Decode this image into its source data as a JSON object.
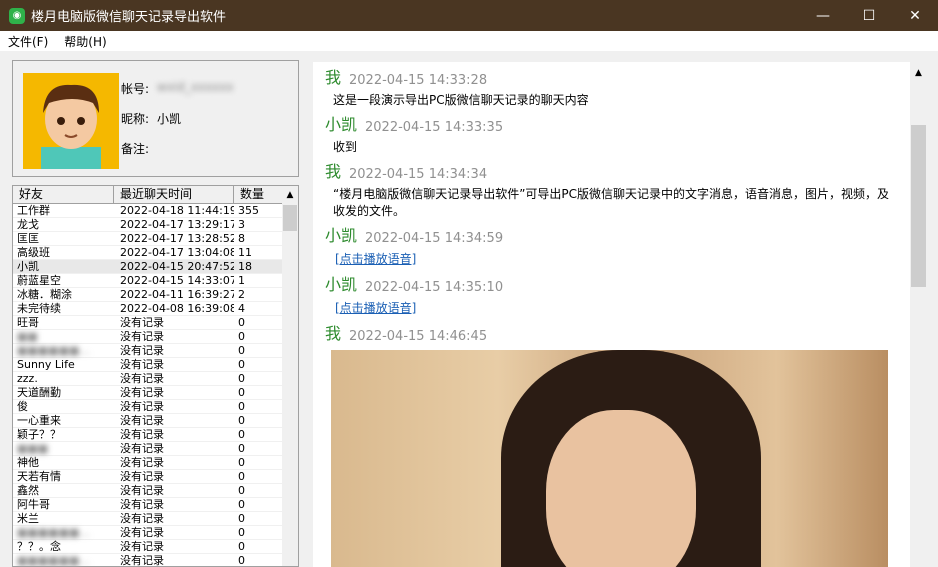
{
  "window": {
    "title": "楼月电脑版微信聊天记录导出软件",
    "icon": "wechat-icon",
    "min": "—",
    "max": "☐",
    "close": "✕"
  },
  "menu": [
    {
      "label": "文件(F)"
    },
    {
      "label": "帮助(H)"
    }
  ],
  "profile": {
    "account_label": "帐号:",
    "account_value": "wxid_xxxxxx",
    "nickname_label": "昵称:",
    "nickname": "小凯",
    "remark_label": "备注:"
  },
  "friends": {
    "headers": [
      "好友",
      "最近聊天时间",
      "数量"
    ],
    "rows": [
      [
        "工作群",
        "2022-04-18 11:44:19",
        "355"
      ],
      [
        "龙戈",
        "2022-04-17 13:29:17",
        "3"
      ],
      [
        "匡匡",
        "2022-04-17 13:28:52",
        "8"
      ],
      [
        "高级班",
        "2022-04-17 13:04:08",
        "11"
      ],
      [
        "小凯",
        "2022-04-15 20:47:52",
        "18"
      ],
      [
        "蔚蓝星空",
        "2022-04-15 14:33:07",
        "1"
      ],
      [
        "冰糖．糊涂",
        "2022-04-11 16:39:27",
        "2"
      ],
      [
        "未完待续",
        "2022-04-08 16:39:08",
        "4"
      ],
      [
        "旺哥",
        "没有记录",
        "0"
      ],
      [
        "■■",
        "没有记录",
        "0"
      ],
      [
        "■■■■■■...",
        "没有记录",
        "0"
      ],
      [
        "Sunny Life",
        "没有记录",
        "0"
      ],
      [
        "zzz.",
        "没有记录",
        "0"
      ],
      [
        "天道酬勤",
        "没有记录",
        "0"
      ],
      [
        "俊",
        "没有记录",
        "0"
      ],
      [
        "一心重来",
        "没有记录",
        "0"
      ],
      [
        "颖子？？",
        "没有记录",
        "0"
      ],
      [
        "■■■",
        "没有记录",
        "0"
      ],
      [
        "神他",
        "没有记录",
        "0"
      ],
      [
        "天若有情",
        "没有记录",
        "0"
      ],
      [
        "鑫然",
        "没有记录",
        "0"
      ],
      [
        "阿牛哥",
        "没有记录",
        "0"
      ],
      [
        "米兰",
        "没有记录",
        "0"
      ],
      [
        "■■■■■■...",
        "没有记录",
        "0"
      ],
      [
        "？？。念",
        "没有记录",
        "0"
      ],
      [
        "■■■■■■...",
        "没有记录",
        "0"
      ]
    ]
  },
  "messages": [
    {
      "sender": "我",
      "time": "2022-04-15 14:33:28",
      "text": "这是一段演示导出PC版微信聊天记录的聊天内容"
    },
    {
      "sender": "小凯",
      "time": "2022-04-15 14:33:35",
      "text": "收到"
    },
    {
      "sender": "我",
      "time": "2022-04-15 14:34:34",
      "text": "“楼月电脑版微信聊天记录导出软件”可导出PC版微信聊天记录中的文字消息，语音消息，图片，视频，及收发的文件。"
    },
    {
      "sender": "小凯",
      "time": "2022-04-15 14:34:59",
      "link": "[点击播放语音]"
    },
    {
      "sender": "小凯",
      "time": "2022-04-15 14:35:10",
      "link": "[点击播放语音]"
    },
    {
      "sender": "我",
      "time": "2022-04-15 14:46:45",
      "image": "photo"
    }
  ]
}
